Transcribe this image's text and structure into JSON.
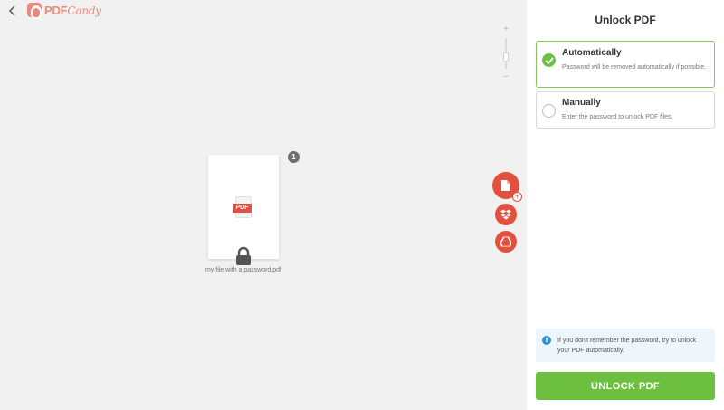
{
  "app": {
    "logo_text": "PDF",
    "logo_sub": "Candy"
  },
  "toolbar": {
    "zoom_in": "+",
    "zoom_out": "–",
    "zoom_level": 0.5
  },
  "document": {
    "file_name": "my file with a password.pdf",
    "file_type": "PDF",
    "page_count": "1",
    "locked": true
  },
  "panel": {
    "title": "Unlock PDF",
    "options": [
      {
        "label": "Automatically",
        "description": "Password will be removed automatically if possible.",
        "selected": true
      },
      {
        "label": "Manually",
        "description": "Enter the password to unlock PDF files.",
        "selected": false
      }
    ],
    "info_text": "If you don't remember the password, try to unlock your PDF automatically.",
    "unlock_label": "UNLOCK PDF"
  },
  "icons": {
    "back": "chevron-left-icon",
    "logo": "pdfcandy-logo-icon",
    "file": "pdf-file-icon",
    "lock": "lock-icon",
    "add_file": "add-file-icon",
    "dropbox": "dropbox-icon",
    "drive": "google-drive-icon",
    "check": "check-icon",
    "info": "info-icon"
  },
  "colors": {
    "accent_green": "#6cbf3f",
    "brand_red": "#e3503e",
    "info_blue": "#2c8fd6",
    "left_bg": "#f1f1f1"
  }
}
